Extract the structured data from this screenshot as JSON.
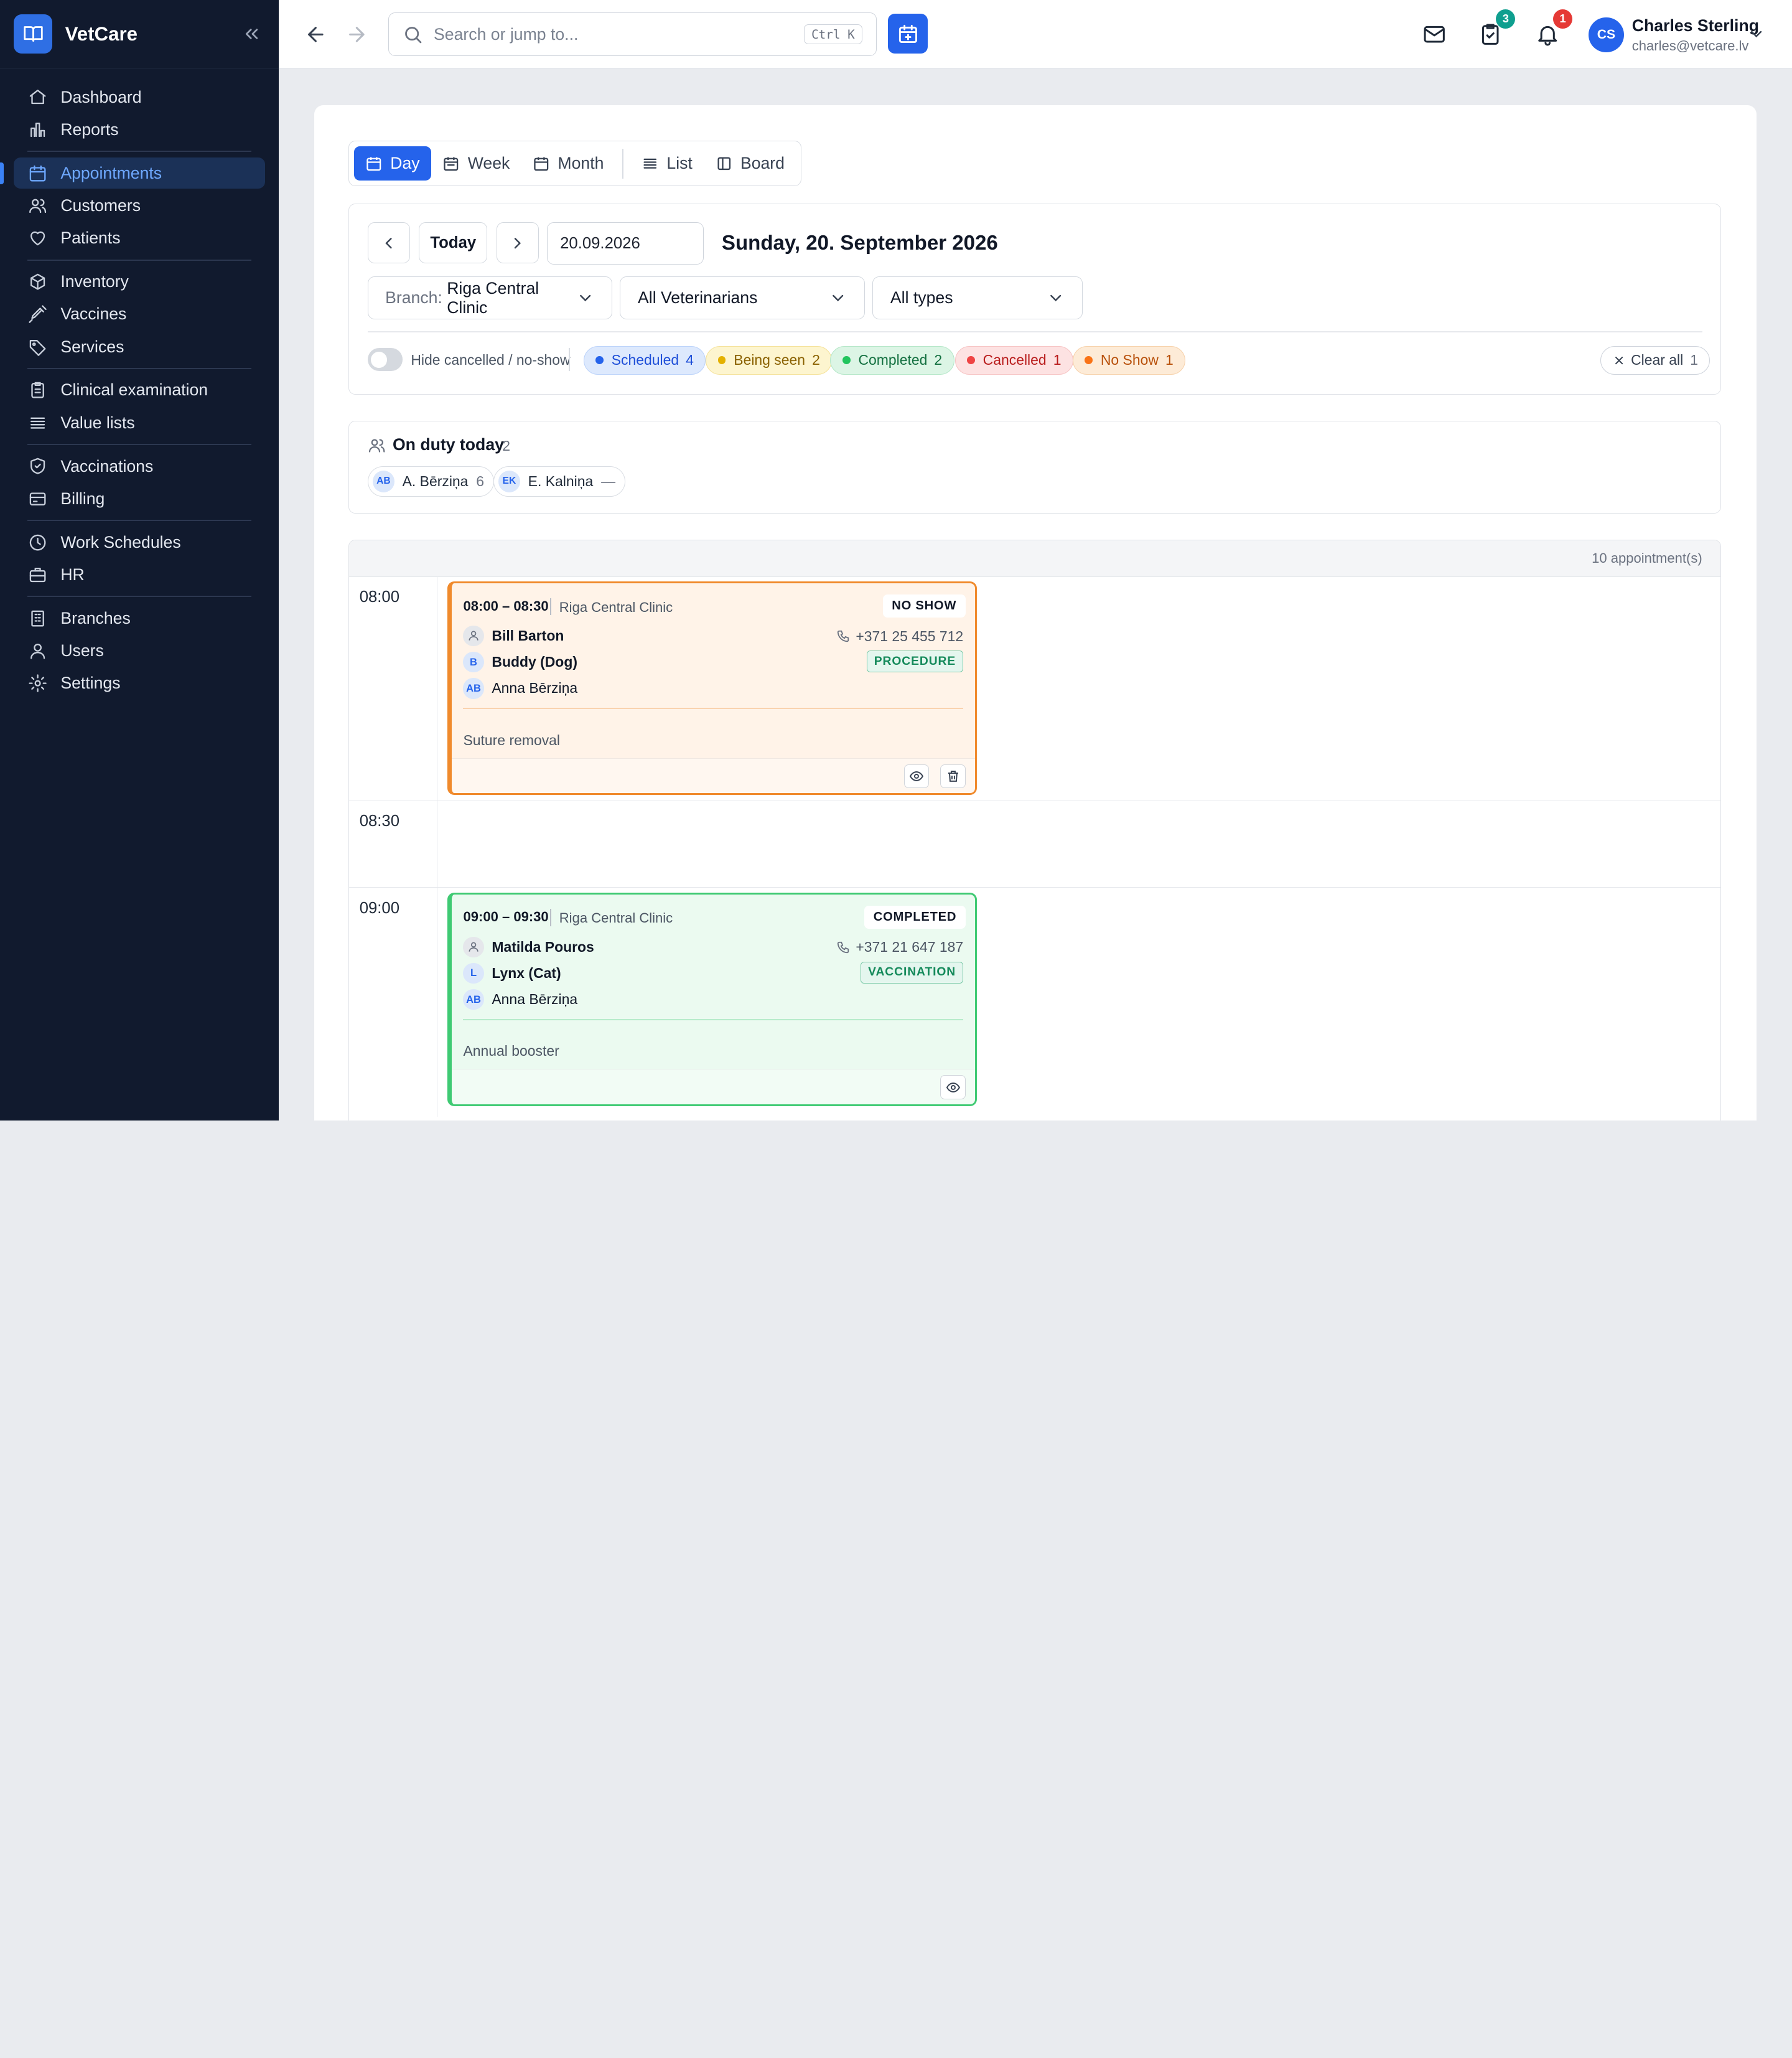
{
  "app": {
    "name": "VetCare"
  },
  "sidebar": {
    "groups": [
      [
        {
          "label": "Dashboard",
          "icon": "home-icon"
        },
        {
          "label": "Reports",
          "icon": "bar-chart-icon"
        }
      ],
      [
        {
          "label": "Appointments",
          "icon": "calendar-icon",
          "active": true
        },
        {
          "label": "Customers",
          "icon": "users-icon"
        },
        {
          "label": "Patients",
          "icon": "heart-icon"
        }
      ],
      [
        {
          "label": "Inventory",
          "icon": "box-icon"
        },
        {
          "label": "Vaccines",
          "icon": "syringe-icon"
        },
        {
          "label": "Services",
          "icon": "tag-icon"
        }
      ],
      [
        {
          "label": "Clinical examination",
          "icon": "clipboard-icon"
        },
        {
          "label": "Value lists",
          "icon": "list-icon"
        }
      ],
      [
        {
          "label": "Vaccinations",
          "icon": "shield-icon"
        },
        {
          "label": "Billing",
          "icon": "credit-card-icon"
        }
      ],
      [
        {
          "label": "Work Schedules",
          "icon": "clock-icon"
        },
        {
          "label": "HR",
          "icon": "briefcase-icon"
        }
      ],
      [
        {
          "label": "Branches",
          "icon": "building-icon"
        },
        {
          "label": "Users",
          "icon": "user-icon"
        },
        {
          "label": "Settings",
          "icon": "gear-icon"
        }
      ]
    ]
  },
  "topbar": {
    "search_placeholder": "Search or jump to...",
    "shortcut": "Ctrl K",
    "tasks_badge": "3",
    "notifications_badge": "1",
    "user": {
      "initials": "CS",
      "name": "Charles Sterling",
      "email": "charles@vetcare.lv"
    }
  },
  "views": {
    "day": "Day",
    "week": "Week",
    "month": "Month",
    "list": "List",
    "board": "Board"
  },
  "filters": {
    "today": "Today",
    "date_value": "20.09.2026",
    "date_title": "Sunday, 20. September 2026",
    "branch_prefix": "Branch:",
    "branch_value": "Riga Central Clinic",
    "vets": "All Veterinarians",
    "types": "All types",
    "hide_cancelled": "Hide cancelled / no-show",
    "statuses": [
      {
        "label": "Scheduled",
        "count": "4",
        "bg": "#dde9fd",
        "fg": "#1d4ed8",
        "dot": "#2563eb",
        "border": "#bcd3fa"
      },
      {
        "label": "Being seen",
        "count": "2",
        "bg": "#fdf5cf",
        "fg": "#8a6100",
        "dot": "#e4b100",
        "border": "#f5e29a"
      },
      {
        "label": "Completed",
        "count": "2",
        "bg": "#dcf5e5",
        "fg": "#137040",
        "dot": "#22c55e",
        "border": "#b5e7c8"
      },
      {
        "label": "Cancelled",
        "count": "1",
        "bg": "#fde2e2",
        "fg": "#b91c1c",
        "dot": "#ef4444",
        "border": "#f7c4c4"
      },
      {
        "label": "No Show",
        "count": "1",
        "bg": "#fdebd7",
        "fg": "#b8500a",
        "dot": "#f97316",
        "border": "#f7d2ab"
      }
    ],
    "clear_all": "Clear all",
    "clear_count": "1"
  },
  "duty": {
    "title": "On duty today",
    "count": "2",
    "people": [
      {
        "initials": "AB",
        "name": "A. Bērziņa",
        "count": "6"
      },
      {
        "initials": "EK",
        "name": "E. Kalniņa",
        "count": "—"
      }
    ]
  },
  "schedule": {
    "summary": "10 appointment(s)",
    "slots": [
      "08:00",
      "08:30",
      "09:00"
    ],
    "appointments": [
      {
        "time": "08:00 – 08:30",
        "branch": "Riga Central Clinic",
        "status": "NO SHOW",
        "client": "Bill Barton",
        "phone": "+371 25 455 712",
        "pet_initial": "B",
        "pet": "Buddy (Dog)",
        "type": "PROCEDURE",
        "vet_initials": "AB",
        "vet": "Anna Bērziņa",
        "note": "Suture removal",
        "border": "#f08a2c",
        "bg": "#fff3e8"
      },
      {
        "time": "09:00 – 09:30",
        "branch": "Riga Central Clinic",
        "status": "COMPLETED",
        "client": "Matilda Pouros",
        "phone": "+371 21 647 187",
        "pet_initial": "L",
        "pet": "Lynx (Cat)",
        "type": "VACCINATION",
        "vet_initials": "AB",
        "vet": "Anna Bērziņa",
        "note": "Annual booster",
        "border": "#3fca73",
        "bg": "#ebfaf0"
      }
    ]
  }
}
